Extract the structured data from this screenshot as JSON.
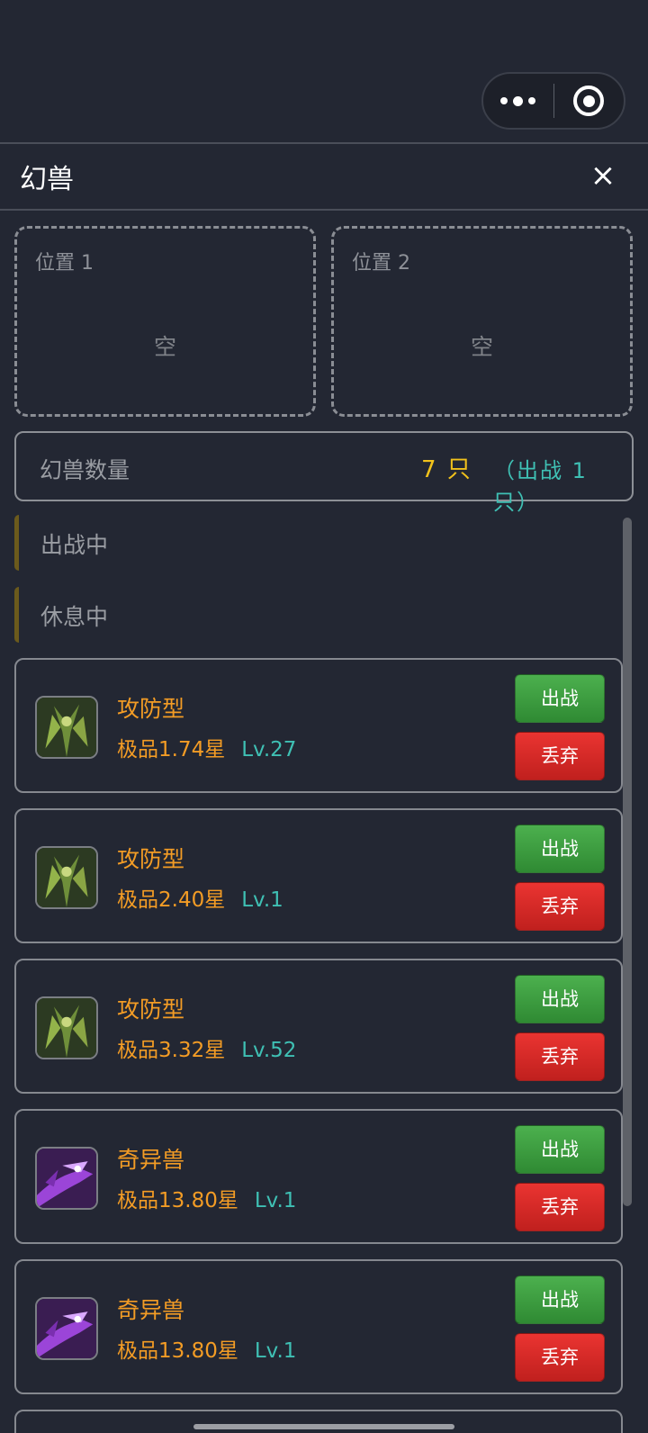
{
  "header": {
    "title": "幻兽",
    "close_label": "×"
  },
  "capsule": {
    "menu_icon": "more-dots-icon",
    "close_icon": "target-circle-icon"
  },
  "slots": [
    {
      "label": "位置 1",
      "status": "空"
    },
    {
      "label": "位置 2",
      "status": "空"
    }
  ],
  "summary": {
    "label": "幻兽数量",
    "count": "7 只",
    "deployed": "（出战 1 只）"
  },
  "sections": {
    "active": "出战中",
    "resting": "休息中"
  },
  "beasts": [
    {
      "type": "攻防型",
      "quality": "极品1.74星",
      "level": "Lv.27",
      "icon": "plant-beast-icon",
      "fight_label": "出战",
      "drop_label": "丢弃"
    },
    {
      "type": "攻防型",
      "quality": "极品2.40星",
      "level": "Lv.1",
      "icon": "plant-beast-icon",
      "fight_label": "出战",
      "drop_label": "丢弃"
    },
    {
      "type": "攻防型",
      "quality": "极品3.32星",
      "level": "Lv.52",
      "icon": "plant-beast-icon",
      "fight_label": "出战",
      "drop_label": "丢弃"
    },
    {
      "type": "奇异兽",
      "quality": "极品13.80星",
      "level": "Lv.1",
      "icon": "purple-beast-icon",
      "fight_label": "出战",
      "drop_label": "丢弃"
    },
    {
      "type": "奇异兽",
      "quality": "极品13.80星",
      "level": "Lv.1",
      "icon": "purple-beast-icon",
      "fight_label": "出战",
      "drop_label": "丢弃"
    }
  ],
  "colors": {
    "background": "#232733",
    "orange": "#f39c25",
    "teal": "#3fc0b4",
    "gold": "#f2c21b",
    "green": "#43a047",
    "red": "#d32f2f"
  }
}
